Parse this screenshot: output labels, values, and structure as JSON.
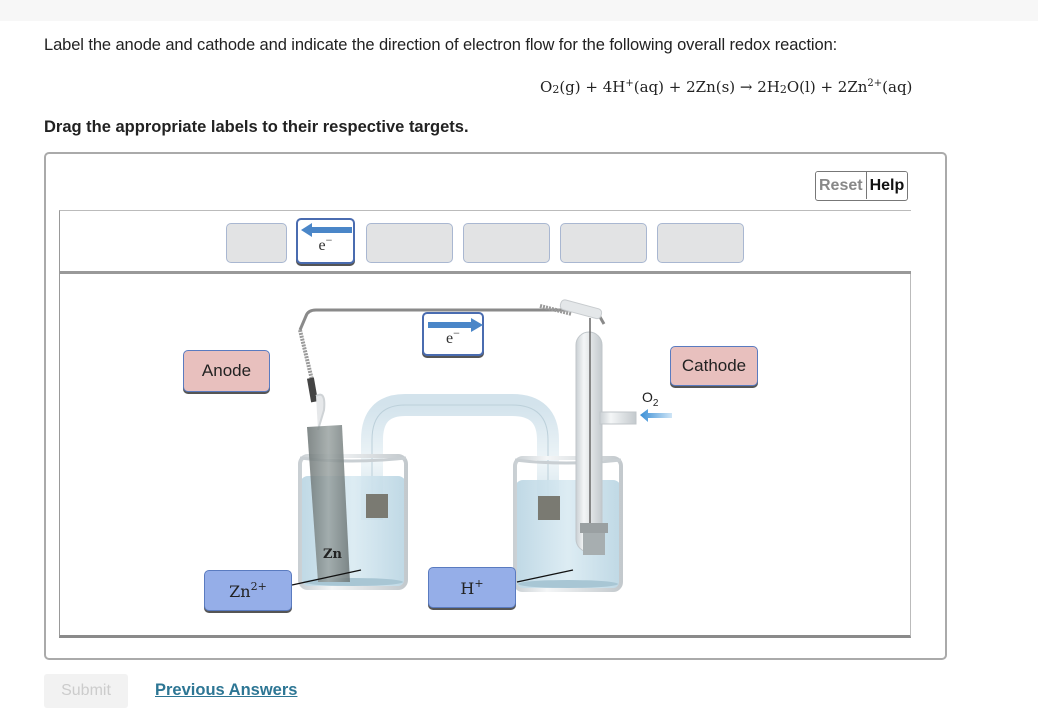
{
  "question": {
    "prompt": "Label the anode and cathode and indicate the direction of electron flow for the following overall redox reaction:",
    "equation": {
      "r1": "O",
      "r1_sub": "2",
      "r1_state": "(g) + 4H",
      "r2_sup": "+",
      "r2_state": "(aq) + 2Zn(s) → 2H",
      "p1_sub": "2",
      "p1_rest": "O(l) + 2Zn",
      "p2_sup": "2+",
      "p2_state": "(aq)"
    },
    "instruction": "Drag the appropriate labels to their respective targets."
  },
  "toolbar": {
    "reset_label": "Reset",
    "help_label": "Help"
  },
  "tray": {
    "slot_count": 6,
    "items": [
      {
        "type": "empty"
      },
      {
        "type": "electron-arrow",
        "direction": "left",
        "symbol": "e",
        "charge": "−"
      },
      {
        "type": "empty"
      },
      {
        "type": "empty"
      },
      {
        "type": "empty"
      },
      {
        "type": "empty"
      }
    ]
  },
  "placed_labels": {
    "anode": "Anode",
    "cathode": "Cathode",
    "electron_arrow": {
      "direction": "right",
      "symbol": "e",
      "charge": "−"
    },
    "zn_ion": {
      "base": "Zn",
      "sup": "2+"
    },
    "h_ion": {
      "base": "H",
      "sup": "+"
    }
  },
  "diagram": {
    "zn_electrode_label": "Zn",
    "o2_label_base": "O",
    "o2_label_sub": "2"
  },
  "footer": {
    "submit_label": "Submit",
    "previous_answers_label": "Previous Answers"
  },
  "colors": {
    "chip_pink": "#e8c0be",
    "chip_blue": "#95aee8",
    "chip_border": "#5a7bc0",
    "arrow_blue": "#4a86c8",
    "link": "#2d7694"
  }
}
